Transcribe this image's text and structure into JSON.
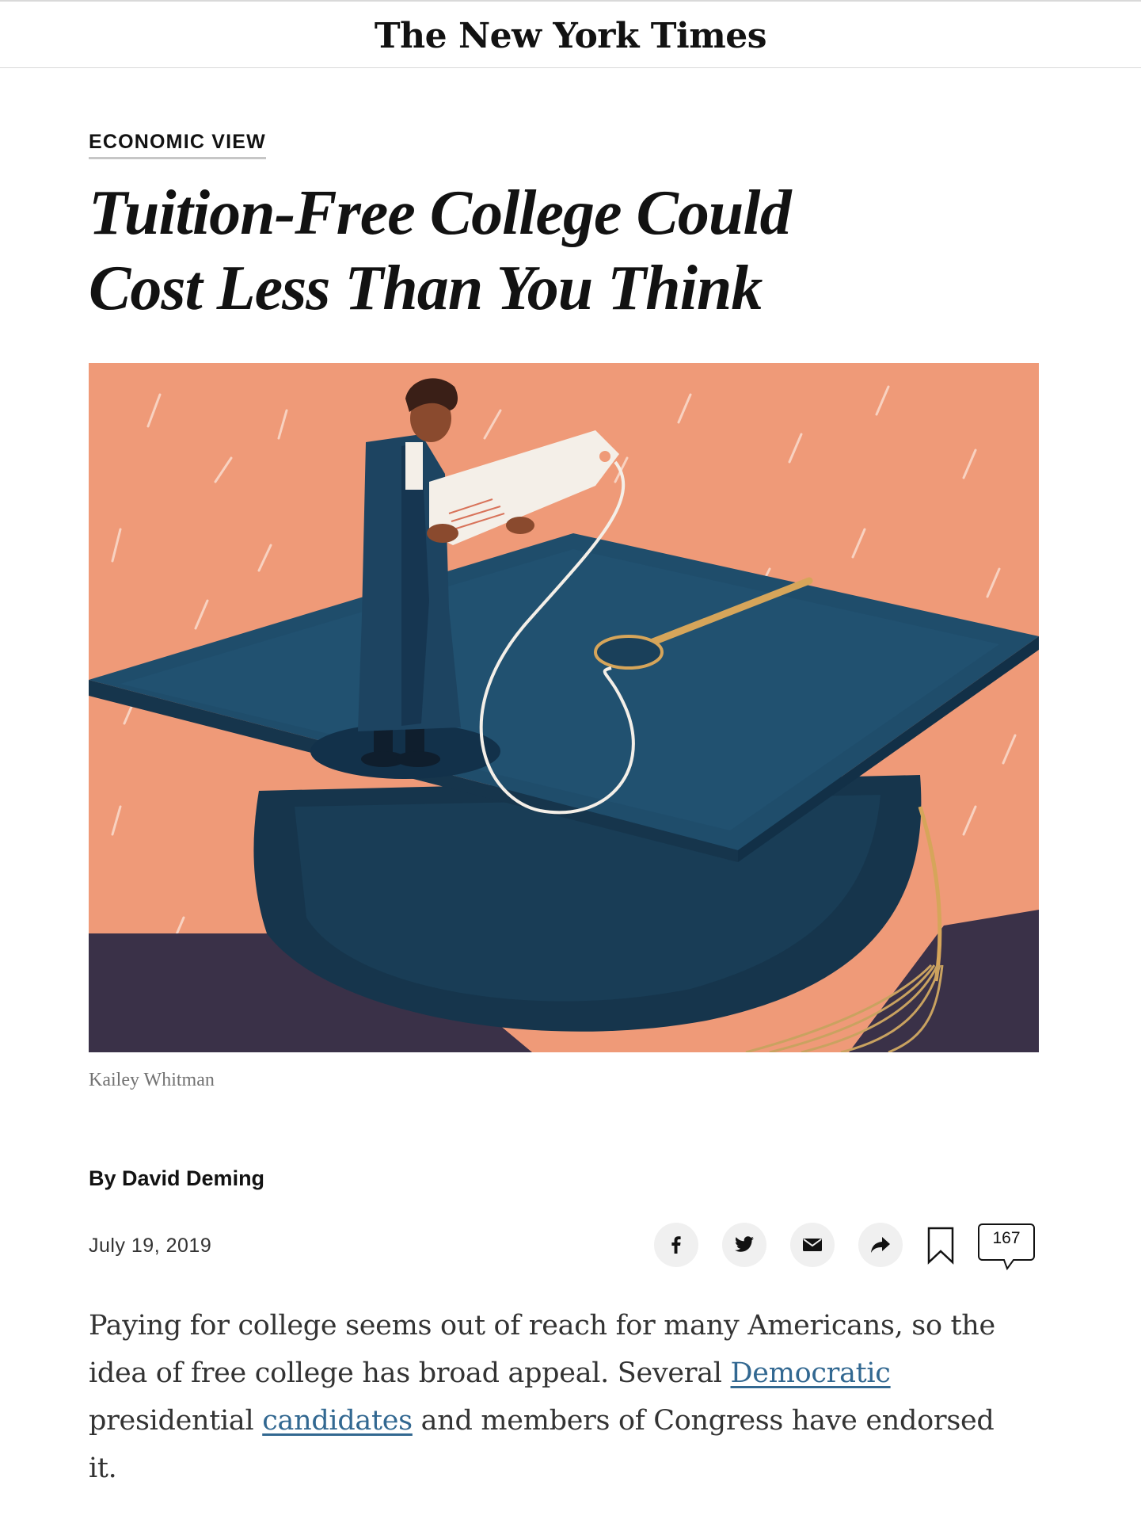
{
  "masthead": {
    "logo": "The New York Times"
  },
  "article": {
    "kicker": "ECONOMIC VIEW",
    "headline": "Tuition-Free College Could Cost Less Than You Think",
    "image_credit": "Kailey Whitman",
    "byline": "By David Deming",
    "date": "July 19, 2019",
    "body": {
      "part1": "Paying for college seems out of reach for many Americans, so the idea of free college has broad appeal. Several ",
      "link1": "Democratic",
      "part2": " presidential ",
      "link2": "candidates",
      "part3": " and members of Congress have endorsed it."
    }
  },
  "share": {
    "icons": [
      "facebook-icon",
      "twitter-icon",
      "email-icon",
      "share-arrow-icon",
      "bookmark-icon",
      "comment-icon"
    ],
    "comment_count": "167"
  },
  "colors": {
    "background": "#ffffff",
    "illustration_background": "#ef9a78",
    "cap": "#1f4d6b",
    "link": "#326891",
    "share_button_bg": "#f0f0f0"
  }
}
